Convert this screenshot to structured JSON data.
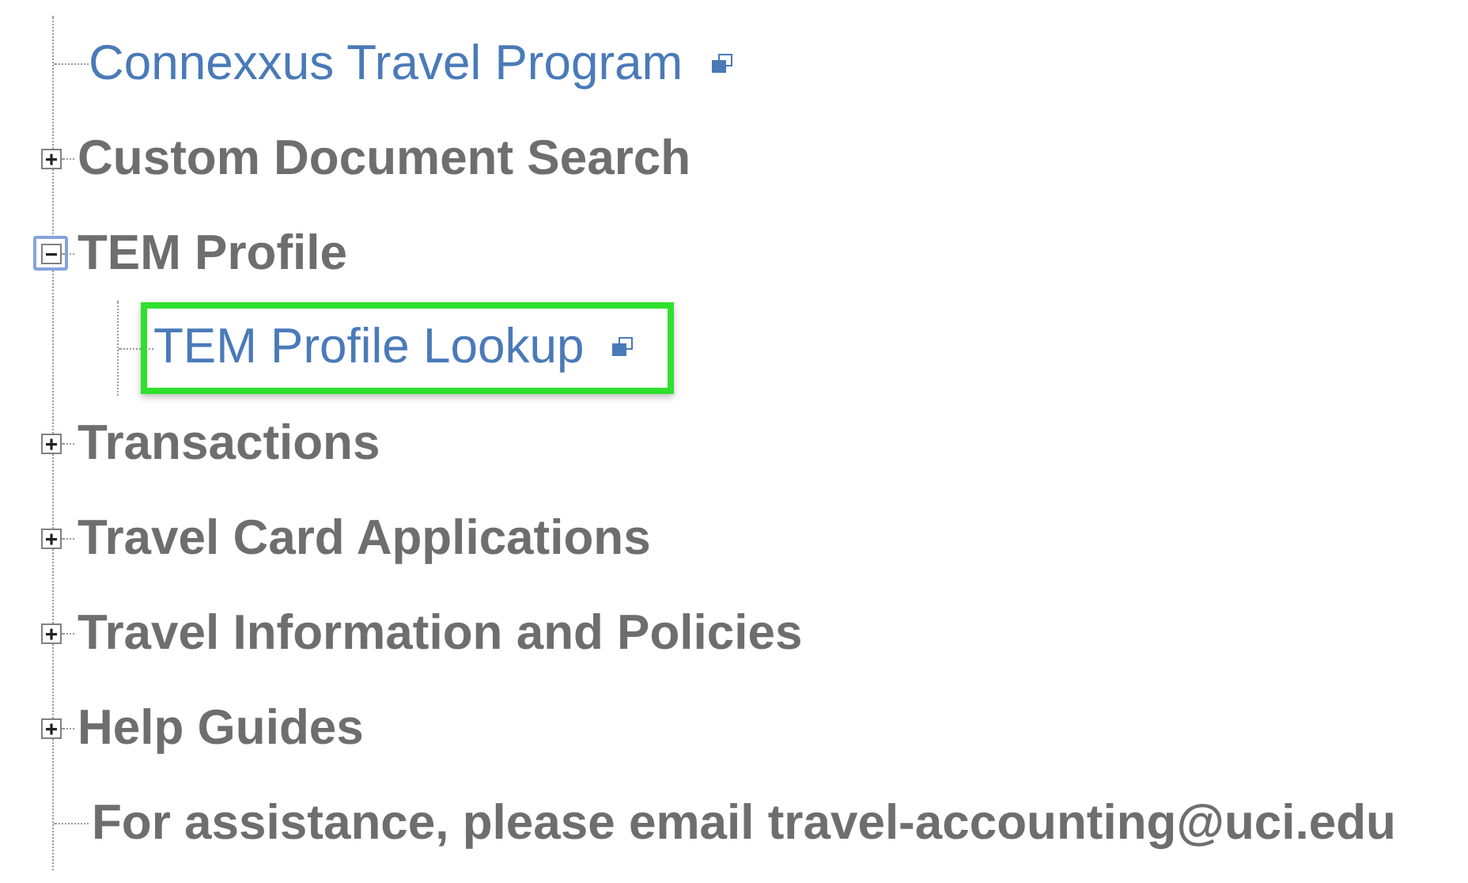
{
  "tree": {
    "items": [
      {
        "kind": "link",
        "label": "Connexxus Travel Program",
        "external": true,
        "highlighted": false
      },
      {
        "kind": "folder",
        "label": "Custom Document Search",
        "expanded": false,
        "focused": false
      },
      {
        "kind": "folder",
        "label": "TEM Profile",
        "expanded": true,
        "focused": true,
        "children": [
          {
            "kind": "link",
            "label": "TEM Profile Lookup",
            "external": true,
            "highlighted": true
          }
        ]
      },
      {
        "kind": "folder",
        "label": "Transactions",
        "expanded": false,
        "focused": false
      },
      {
        "kind": "folder",
        "label": "Travel Card Applications",
        "expanded": false,
        "focused": false
      },
      {
        "kind": "folder",
        "label": "Travel Information and Policies",
        "expanded": false,
        "focused": false
      },
      {
        "kind": "folder",
        "label": "Help Guides",
        "expanded": false,
        "focused": false
      },
      {
        "kind": "text",
        "label": "For assistance, please email travel-accounting@uci.edu"
      }
    ]
  }
}
